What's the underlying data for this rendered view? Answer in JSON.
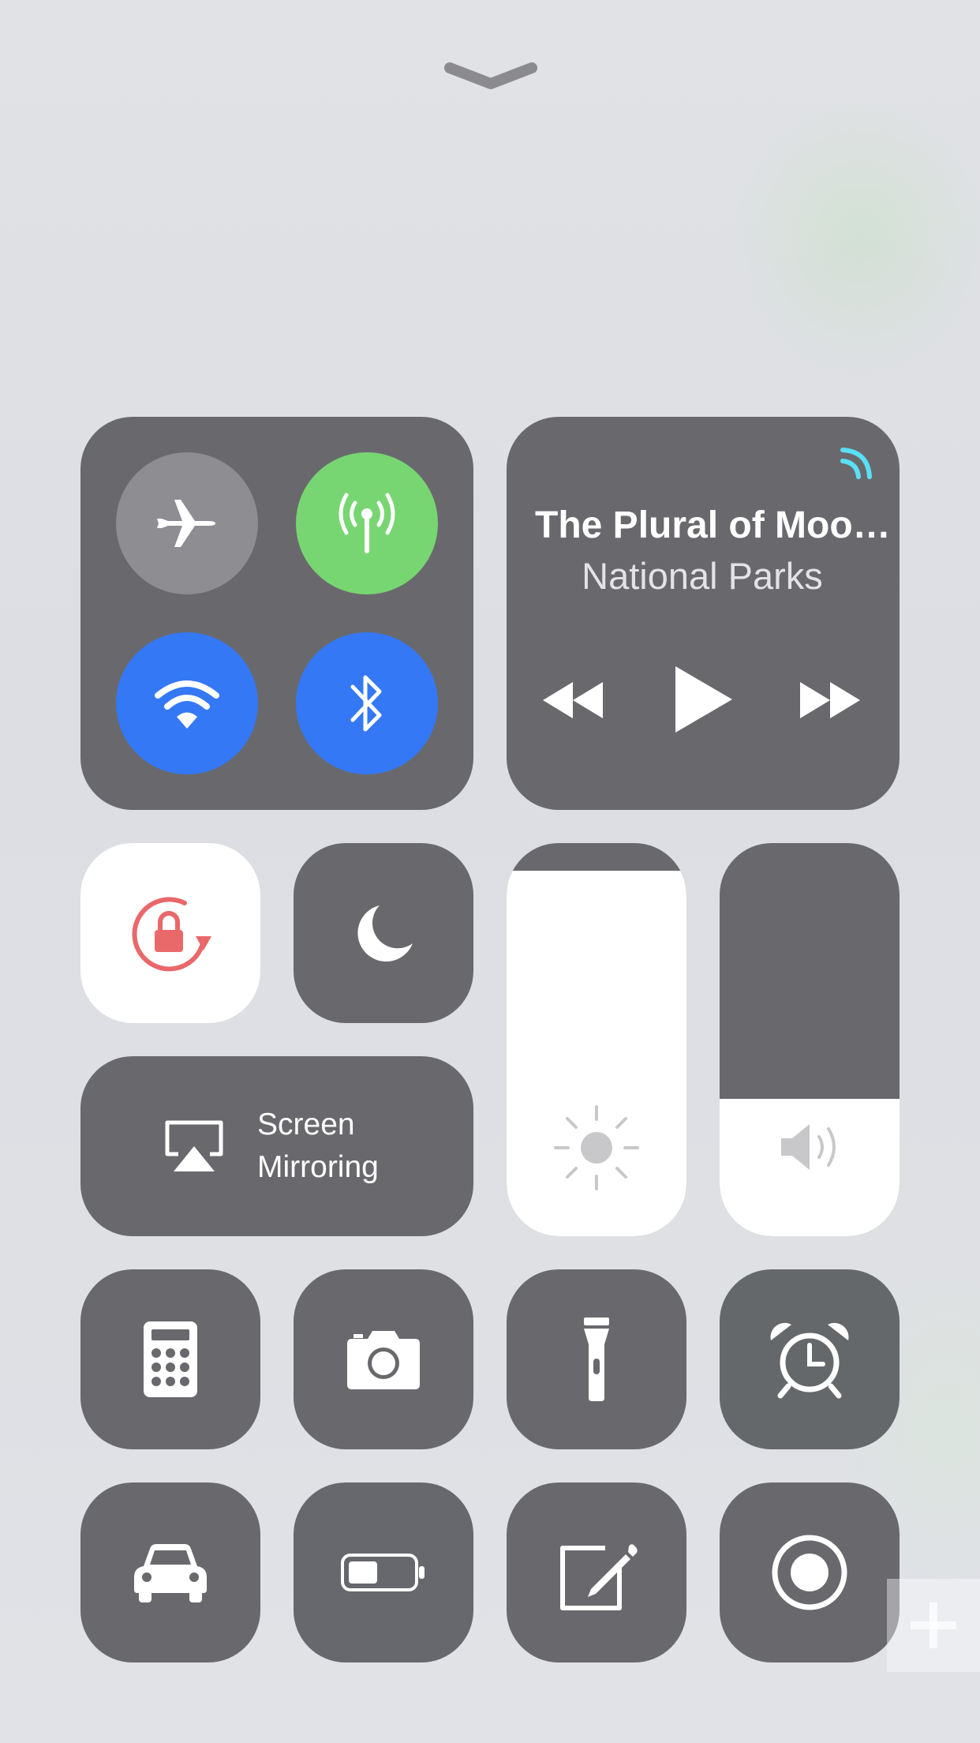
{
  "control_center": {
    "dismiss_handle": "chevron-down-icon",
    "connectivity": {
      "airplane_mode": {
        "icon": "airplane-icon",
        "state": "off"
      },
      "cellular_data": {
        "icon": "antenna-icon",
        "state": "on"
      },
      "wifi": {
        "icon": "wifi-icon",
        "state": "on"
      },
      "bluetooth": {
        "icon": "bluetooth-icon",
        "state": "on"
      }
    },
    "now_playing": {
      "title": "The Plural of Moo…",
      "artist": "National Parks",
      "airplay_icon": "airplay-audio-icon",
      "controls": [
        "rewind-icon",
        "play-icon",
        "fast-forward-icon"
      ]
    },
    "orientation_lock": {
      "icon": "rotation-lock-icon",
      "state": "on"
    },
    "do_not_disturb": {
      "icon": "moon-icon",
      "state": "off"
    },
    "screen_mirroring": {
      "line1": "Screen",
      "line2": "Mirroring",
      "icon": "airplay-screen-icon"
    },
    "brightness": {
      "icon": "sun-icon",
      "level": 0.93
    },
    "volume": {
      "icon": "speaker-icon",
      "level": 0.35
    },
    "shortcuts_row1": [
      "calculator-icon",
      "camera-icon",
      "flashlight-icon",
      "alarm-clock-icon"
    ],
    "shortcuts_row2": [
      "car-icon",
      "low-power-battery-icon",
      "notes-icon",
      "screen-record-icon"
    ]
  },
  "colors": {
    "tile": "#69696d",
    "green": "#78d672",
    "blue": "#3478f6",
    "red_lock": "#e9686a",
    "airplay_cyan": "#5ae0f5"
  }
}
